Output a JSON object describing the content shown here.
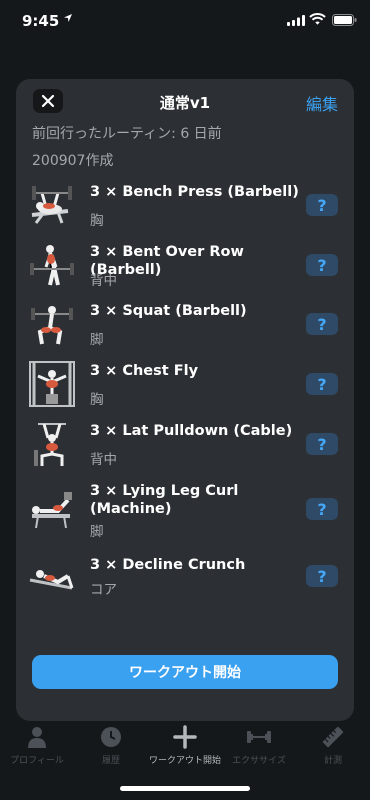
{
  "status_bar": {
    "time": "9:45"
  },
  "sheet": {
    "title": "通常v1",
    "edit_label": "編集",
    "last_done": "前回行ったルーティン: 6 日前",
    "created": "200907作成"
  },
  "exercises": [
    {
      "name": "3 × Bench Press (Barbell)",
      "muscle": "胸",
      "help": "?"
    },
    {
      "name": "3 × Bent Over Row (Barbell)",
      "muscle": "背中",
      "help": "?"
    },
    {
      "name": "3 × Squat (Barbell)",
      "muscle": "脚",
      "help": "?"
    },
    {
      "name": "3 × Chest Fly",
      "muscle": "胸",
      "help": "?"
    },
    {
      "name": "3 × Lat Pulldown (Cable)",
      "muscle": "背中",
      "help": "?"
    },
    {
      "name": "3 × Lying Leg Curl (Machine)",
      "muscle": "脚",
      "help": "?"
    },
    {
      "name": "3 × Decline Crunch",
      "muscle": "コア",
      "help": "?"
    }
  ],
  "start_button": "ワークアウト開始",
  "tabs": [
    {
      "label": "プロフィール",
      "icon": "profile-icon"
    },
    {
      "label": "履歴",
      "icon": "clock-icon"
    },
    {
      "label": "ワークアウト開始",
      "icon": "plus-icon"
    },
    {
      "label": "エクササイズ",
      "icon": "dumbbell-icon"
    },
    {
      "label": "計測",
      "icon": "ruler-icon"
    }
  ],
  "colors": {
    "accent": "#3aa0f0",
    "sheet_bg": "#2c3034",
    "background": "#15181b"
  }
}
